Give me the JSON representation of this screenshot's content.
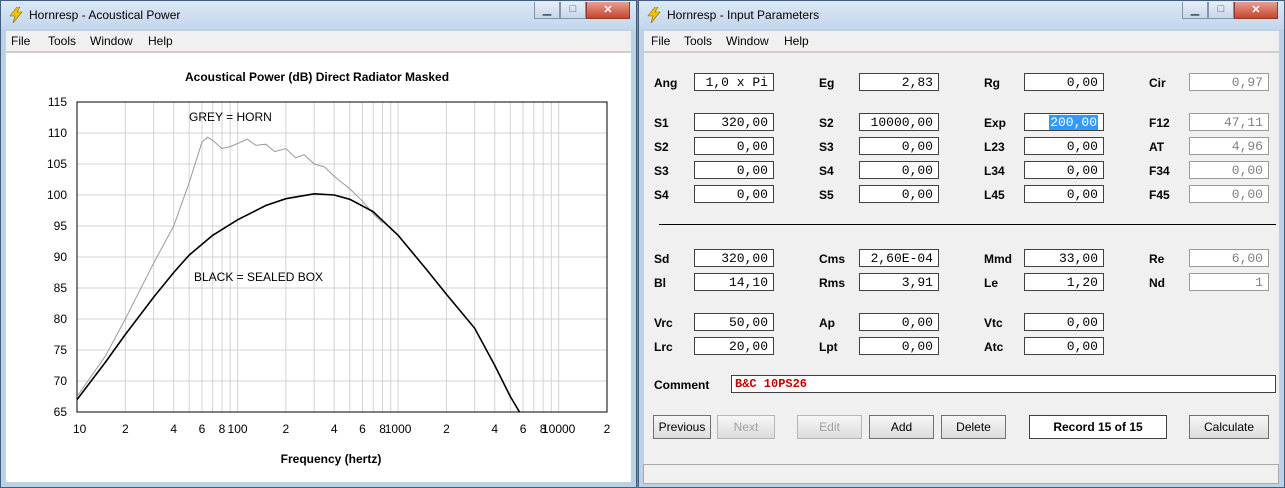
{
  "left_window": {
    "title": "Hornresp - Acoustical Power",
    "menu": [
      "File",
      "Tools",
      "Window",
      "Help"
    ],
    "chart_title": "Acoustical Power (dB)   Direct Radiator   Masked",
    "annotation_grey": "GREY = HORN",
    "annotation_black": "BLACK = SEALED BOX"
  },
  "right_window": {
    "title": "Hornresp - Input Parameters",
    "menu": [
      "File",
      "Tools",
      "Window",
      "Help"
    ],
    "params": {
      "Ang": "1,0 x Pi",
      "Eg": "2,83",
      "Rg": "0,00",
      "Cir": "0,97",
      "S1": "320,00",
      "S2a": "10000,00",
      "Exp": "200,00",
      "F12": "47,11",
      "S2": "0,00",
      "S3a": "0,00",
      "L23": "0,00",
      "AT": "4,96",
      "S3": "0,00",
      "S4a": "0,00",
      "L34": "0,00",
      "F34": "0,00",
      "S4": "0,00",
      "S5": "0,00",
      "L45": "0,00",
      "F45": "0,00",
      "Sd": "320,00",
      "Cms": "2,60E-04",
      "Mmd": "33,00",
      "Re": "6,00",
      "Bl": "14,10",
      "Rms": "3,91",
      "Le": "1,20",
      "Nd": "1",
      "Vrc": "50,00",
      "Ap": "0,00",
      "Vtc": "0,00",
      "Lrc": "20,00",
      "Lpt": "0,00",
      "Atc": "0,00"
    },
    "labels": {
      "Ang": "Ang",
      "Eg": "Eg",
      "Rg": "Rg",
      "Cir": "Cir",
      "S1": "S1",
      "S2a": "S2",
      "Exp": "Exp",
      "F12": "F12",
      "S2": "S2",
      "S3a": "S3",
      "L23": "L23",
      "AT": "AT",
      "S3": "S3",
      "S4a": "S4",
      "L34": "L34",
      "F34": "F34",
      "S4": "S4",
      "S5": "S5",
      "L45": "L45",
      "F45": "F45",
      "Sd": "Sd",
      "Cms": "Cms",
      "Mmd": "Mmd",
      "Re": "Re",
      "Bl": "Bl",
      "Rms": "Rms",
      "Le": "Le",
      "Nd": "Nd",
      "Vrc": "Vrc",
      "Ap": "Ap",
      "Vtc": "Vtc",
      "Lrc": "Lrc",
      "Lpt": "Lpt",
      "Atc": "Atc"
    },
    "comment_label": "Comment",
    "comment": "B&C 10PS26",
    "buttons": {
      "previous": "Previous",
      "next": "Next",
      "edit": "Edit",
      "add": "Add",
      "delete": "Delete",
      "calculate": "Calculate"
    },
    "record": "Record 15 of 15"
  },
  "chart_data": {
    "type": "line",
    "title": "Acoustical Power (dB)   Direct Radiator   Masked",
    "xlabel": "Frequency (hertz)",
    "ylabel": "",
    "x_scale": "log",
    "xlim": [
      10,
      20000
    ],
    "ylim": [
      65,
      115
    ],
    "yticks": [
      65,
      70,
      75,
      80,
      85,
      90,
      95,
      100,
      105,
      110,
      115
    ],
    "xtick_labels": [
      "10",
      "2",
      "4",
      "6",
      "8",
      "100",
      "2",
      "4",
      "6",
      "8",
      "1000",
      "2",
      "4",
      "6",
      "8",
      "10000",
      "2"
    ],
    "grid": true,
    "series": [
      {
        "name": "GREY = HORN",
        "color": "#9a9a9a",
        "points": [
          [
            10,
            67.5
          ],
          [
            15,
            74
          ],
          [
            20,
            80
          ],
          [
            30,
            89
          ],
          [
            40,
            95
          ],
          [
            50,
            102
          ],
          [
            60,
            108.5
          ],
          [
            65,
            109.3
          ],
          [
            70,
            108.8
          ],
          [
            80,
            107.5
          ],
          [
            90,
            107.8
          ],
          [
            100,
            108.3
          ],
          [
            115,
            109
          ],
          [
            130,
            108
          ],
          [
            150,
            108.2
          ],
          [
            170,
            107
          ],
          [
            200,
            107.5
          ],
          [
            230,
            106
          ],
          [
            260,
            106.5
          ],
          [
            300,
            105
          ],
          [
            350,
            104.5
          ],
          [
            400,
            103
          ],
          [
            500,
            101
          ],
          [
            600,
            99
          ],
          [
            700,
            97
          ],
          [
            800,
            95.5
          ]
        ]
      },
      {
        "name": "BLACK = SEALED BOX",
        "color": "#000000",
        "points": [
          [
            10,
            67
          ],
          [
            15,
            73
          ],
          [
            20,
            77.5
          ],
          [
            30,
            83.5
          ],
          [
            40,
            87.5
          ],
          [
            50,
            90.3
          ],
          [
            70,
            93.5
          ],
          [
            100,
            96
          ],
          [
            150,
            98.3
          ],
          [
            200,
            99.4
          ],
          [
            300,
            100.2
          ],
          [
            400,
            100
          ],
          [
            500,
            99.3
          ],
          [
            700,
            97.3
          ],
          [
            1000,
            93.5
          ],
          [
            1500,
            88
          ],
          [
            2000,
            84
          ],
          [
            3000,
            78.5
          ],
          [
            4000,
            72.5
          ],
          [
            5000,
            67.5
          ],
          [
            5700,
            65
          ]
        ]
      }
    ]
  }
}
